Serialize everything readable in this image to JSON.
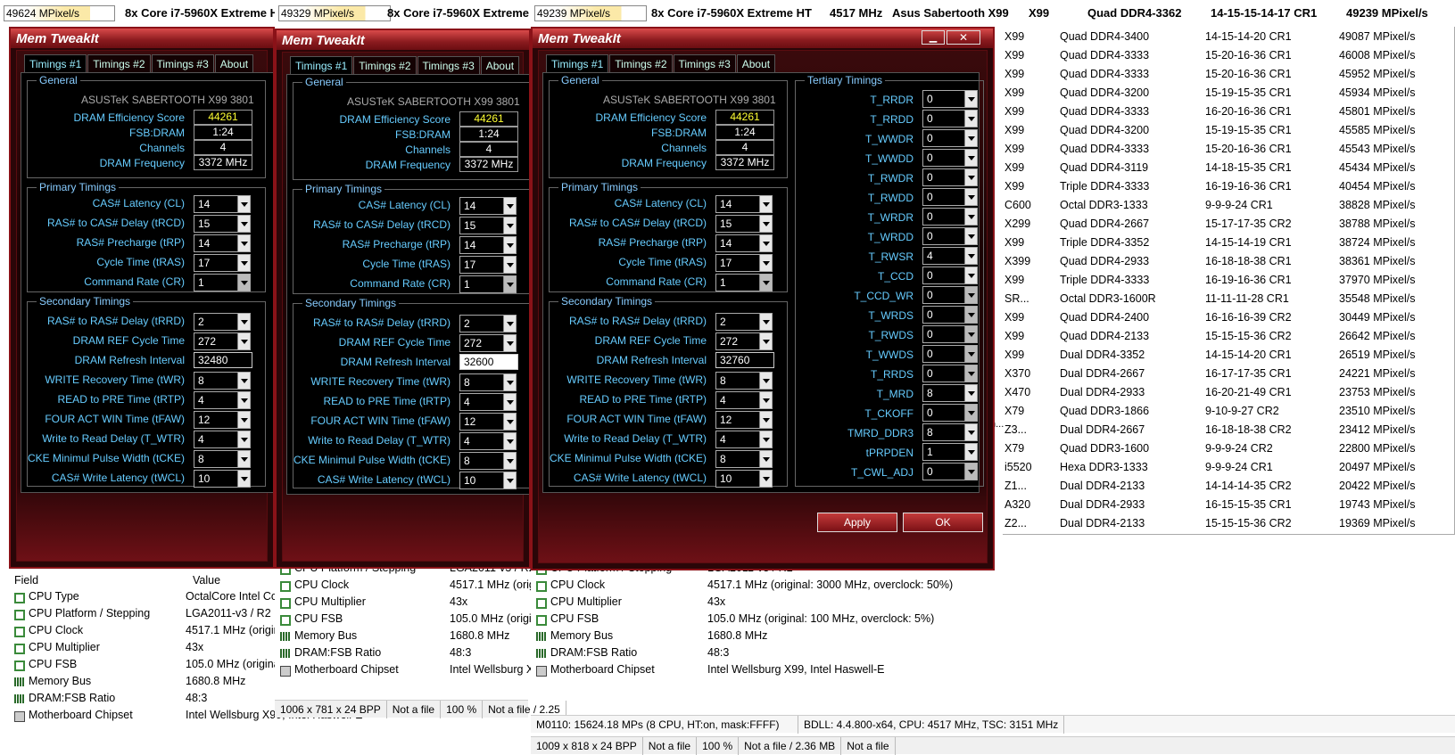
{
  "strips": [
    {
      "mpx": "49624 MPixel/s",
      "cpu": "8x Core i7-5960X Extreme HT"
    },
    {
      "mpx": "49329 MPixel/s",
      "cpu": "8x Core i7-5960X Extreme HT"
    },
    {
      "mpx": "49239 MPixel/s",
      "cpu": "8x Core i7-5960X Extreme HT",
      "freq": "4517 MHz",
      "board": "Asus Sabertooth X99"
    }
  ],
  "top_row": {
    "chip": "X99",
    "mem": "Quad DDR4-3362",
    "timing": "14-15-15-14-17 CR1",
    "score": "49239 MPixel/s"
  },
  "rank_rows": [
    {
      "chip": "X99",
      "mem": "Quad DDR4-3400",
      "timing": "14-15-14-20 CR1",
      "score": "49087 MPixel/s"
    },
    {
      "chip": "X99",
      "mem": "Quad DDR4-3333",
      "timing": "15-20-16-36 CR1",
      "score": "46008 MPixel/s"
    },
    {
      "chip": "X99",
      "mem": "Quad DDR4-3333",
      "timing": "15-20-16-36 CR1",
      "score": "45952 MPixel/s"
    },
    {
      "chip": "X99",
      "mem": "Quad DDR4-3200",
      "timing": "15-19-15-35 CR1",
      "score": "45934 MPixel/s"
    },
    {
      "chip": "X99",
      "mem": "Quad DDR4-3333",
      "timing": "16-20-16-36 CR1",
      "score": "45801 MPixel/s"
    },
    {
      "chip": "X99",
      "mem": "Quad DDR4-3200",
      "timing": "15-19-15-35 CR1",
      "score": "45585 MPixel/s"
    },
    {
      "chip": "X99",
      "mem": "Quad DDR4-3333",
      "timing": "15-20-16-36 CR1",
      "score": "45543 MPixel/s"
    },
    {
      "chip": "X99",
      "mem": "Quad DDR4-3119",
      "timing": "14-18-15-35 CR1",
      "score": "45434 MPixel/s"
    },
    {
      "chip": "X99",
      "mem": "Triple DDR4-3333",
      "timing": "16-19-16-36 CR1",
      "score": "40454 MPixel/s"
    },
    {
      "chip": "C600",
      "mem": "Octal DDR3-1333",
      "timing": "9-9-9-24 CR1",
      "score": "38828 MPixel/s"
    },
    {
      "chip": "X299",
      "mem": "Quad DDR4-2667",
      "timing": "15-17-17-35 CR2",
      "score": "38788 MPixel/s"
    },
    {
      "chip": "X99",
      "mem": "Triple DDR4-3352",
      "timing": "14-15-14-19 CR1",
      "score": "38724 MPixel/s"
    },
    {
      "chip": "X399",
      "mem": "Quad DDR4-2933",
      "timing": "16-18-18-38 CR1",
      "score": "38361 MPixel/s"
    },
    {
      "chip": "X99",
      "mem": "Triple DDR4-3333",
      "timing": "16-19-16-36 CR1",
      "score": "37970 MPixel/s"
    },
    {
      "chip": "SR...",
      "mem": "Octal DDR3-1600R",
      "timing": "11-11-11-28 CR1",
      "score": "35548 MPixel/s"
    },
    {
      "chip": "X99",
      "mem": "Quad DDR4-2400",
      "timing": "16-16-16-39 CR2",
      "score": "30449 MPixel/s"
    },
    {
      "chip": "X99",
      "mem": "Quad DDR4-2133",
      "timing": "15-15-15-36 CR2",
      "score": "26642 MPixel/s"
    },
    {
      "chip": "X99",
      "mem": "Dual DDR4-3352",
      "timing": "14-15-14-20 CR1",
      "score": "26519 MPixel/s"
    },
    {
      "chip": "X370",
      "mem": "Dual DDR4-2667",
      "timing": "16-17-17-35 CR1",
      "score": "24221 MPixel/s"
    },
    {
      "chip": "X470",
      "mem": "Dual DDR4-2933",
      "timing": "16-20-21-49 CR1",
      "score": "23753 MPixel/s"
    },
    {
      "chip": "X79",
      "mem": "Quad DDR3-1866",
      "timing": "9-10-9-27 CR2",
      "score": "23510 MPixel/s"
    },
    {
      "chip": "Z3...",
      "mem": "Dual DDR4-2667",
      "timing": "16-18-18-38 CR2",
      "score": "23412 MPixel/s"
    },
    {
      "chip": "X79",
      "mem": "Quad DDR3-1600",
      "timing": "9-9-9-24 CR2",
      "score": "22800 MPixel/s"
    },
    {
      "chip": "i5520",
      "mem": "Hexa DDR3-1333",
      "timing": "9-9-9-24 CR1",
      "score": "20497 MPixel/s"
    },
    {
      "chip": "Z1...",
      "mem": "Dual DDR4-2133",
      "timing": "14-14-14-35 CR2",
      "score": "20422 MPixel/s"
    },
    {
      "chip": "A320",
      "mem": "Dual DDR4-2933",
      "timing": "16-15-15-35 CR1",
      "score": "19743 MPixel/s"
    },
    {
      "chip": "Z2...",
      "mem": "Dual DDR4-2133",
      "timing": "15-15-15-36 CR2",
      "score": "19369 MPixel/s"
    }
  ],
  "truncated_n": "n...",
  "mt": {
    "title": "Mem TweakIt",
    "tabs": [
      "Timings #1",
      "Timings #2",
      "Timings #3",
      "About"
    ],
    "general_cap": "General",
    "board": "ASUSTeK SABERTOOTH X99 3801",
    "gen_labels": [
      "DRAM Efficiency Score",
      "FSB:DRAM",
      "Channels",
      "DRAM Frequency"
    ],
    "gen_values": [
      "44261",
      "1:24",
      "4",
      "3372 MHz"
    ],
    "primary_cap": "Primary Timings",
    "prim_labels": [
      "CAS# Latency (CL)",
      "RAS# to CAS# Delay (tRCD)",
      "RAS# Precharge (tRP)",
      "Cycle Time (tRAS)",
      "Command Rate (CR)"
    ],
    "prim_values": [
      "14",
      "15",
      "14",
      "17",
      "1"
    ],
    "secondary_cap": "Secondary Timings",
    "sec_labels": [
      "RAS# to RAS# Delay (tRRD)",
      "DRAM REF Cycle Time",
      "DRAM Refresh Interval",
      "WRITE Recovery Time (tWR)",
      "READ to PRE Time (tRTP)",
      "FOUR ACT WIN Time (tFAW)",
      "Write to Read Delay (T_WTR)",
      "CKE Minimul Pulse Width (tCKE)",
      "CAS# Write Latency (tWCL)"
    ],
    "sec_values": [
      "2",
      "272",
      "",
      "8",
      "4",
      "12",
      "4",
      "8",
      "10"
    ],
    "refresh": [
      "32480",
      "32600",
      "32760"
    ],
    "tertiary_cap": "Tertiary Timings",
    "ter_labels": [
      "T_RRDR",
      "T_RRDD",
      "T_WWDR",
      "T_WWDD",
      "T_RWDR",
      "T_RWDD",
      "T_WRDR",
      "T_WRDD",
      "T_RWSR",
      "T_CCD",
      "T_CCD_WR",
      "T_WRDS",
      "T_RWDS",
      "T_WWDS",
      "T_RRDS",
      "T_MRD",
      "T_CKOFF",
      "TMRD_DDR3",
      "tPRPDEN",
      "T_CWL_ADJ"
    ],
    "ter_values": [
      "0",
      "0",
      "0",
      "0",
      "0",
      "0",
      "0",
      "0",
      "4",
      "0",
      "0",
      "0",
      "0",
      "0",
      "0",
      "8",
      "0",
      "8",
      "1",
      "0"
    ],
    "apply": "Apply",
    "ok": "OK",
    "min": "▁",
    "close": "✕"
  },
  "info": {
    "col_field": "Field",
    "col_value": "Value",
    "rows1": [
      {
        "icon": "cpu",
        "f": "CPU Type",
        "v": "OctalCore Intel Cor"
      },
      {
        "icon": "cpu",
        "f": "CPU Platform / Stepping",
        "v": "LGA2011-v3 / R2"
      },
      {
        "icon": "cpu",
        "f": "CPU Clock",
        "v": "4517.1 MHz  (origin"
      },
      {
        "icon": "cpu",
        "f": "CPU Multiplier",
        "v": "43x"
      },
      {
        "icon": "cpu",
        "f": "CPU FSB",
        "v": "105.0 MHz  (origina"
      },
      {
        "icon": "mem",
        "f": "Memory Bus",
        "v": "1680.8 MHz"
      },
      {
        "icon": "mem",
        "f": "DRAM:FSB Ratio",
        "v": "48:3"
      },
      {
        "icon": "chip",
        "f": "Motherboard Chipset",
        "v": "Intel Wellsburg X99, Intel Haswell-E"
      }
    ],
    "rows2": [
      {
        "icon": "cpu",
        "f": "CPU Platform / Stepping",
        "v": "LGA2011-v3 / R2"
      },
      {
        "icon": "cpu",
        "f": "CPU Clock",
        "v": "4517.1 MHz  (orig"
      },
      {
        "icon": "cpu",
        "f": "CPU Multiplier",
        "v": "43x"
      },
      {
        "icon": "cpu",
        "f": "CPU FSB",
        "v": "105.0 MHz  (origi"
      },
      {
        "icon": "mem",
        "f": "Memory Bus",
        "v": "1680.8 MHz"
      },
      {
        "icon": "mem",
        "f": "DRAM:FSB Ratio",
        "v": "48:3"
      },
      {
        "icon": "chip",
        "f": "Motherboard Chipset",
        "v": "Intel Wellsburg X"
      }
    ],
    "rows3": [
      {
        "icon": "cpu",
        "f": "CPU Platform / Stepping",
        "v": "LGA2011-v3 / R2"
      },
      {
        "icon": "cpu",
        "f": "CPU Clock",
        "v": "4517.1 MHz  (original: 3000 MHz, overclock: 50%)"
      },
      {
        "icon": "cpu",
        "f": "CPU Multiplier",
        "v": "43x"
      },
      {
        "icon": "cpu",
        "f": "CPU FSB",
        "v": "105.0 MHz  (original: 100 MHz, overclock: 5%)"
      },
      {
        "icon": "mem",
        "f": "Memory Bus",
        "v": "1680.8 MHz"
      },
      {
        "icon": "mem",
        "f": "DRAM:FSB Ratio",
        "v": "48:3"
      },
      {
        "icon": "chip",
        "f": "Motherboard Chipset",
        "v": "Intel Wellsburg X99, Intel Haswell-E"
      }
    ]
  },
  "status2": [
    "1006 x 781 x 24 BPP",
    "Not a file",
    "100 %",
    "Not a file / 2.25"
  ],
  "status3a": [
    "M0110: 15624.18 MPs (8 CPU, HT:on, mask:FFFF)",
    "BDLL: 4.4.800-x64, CPU: 4517 MHz, TSC: 3151 MHz"
  ],
  "status3b": [
    "1009 x 818 x 24 BPP",
    "Not a file",
    "100 %",
    "Not a file / 2.36 MB",
    "Not a file"
  ]
}
